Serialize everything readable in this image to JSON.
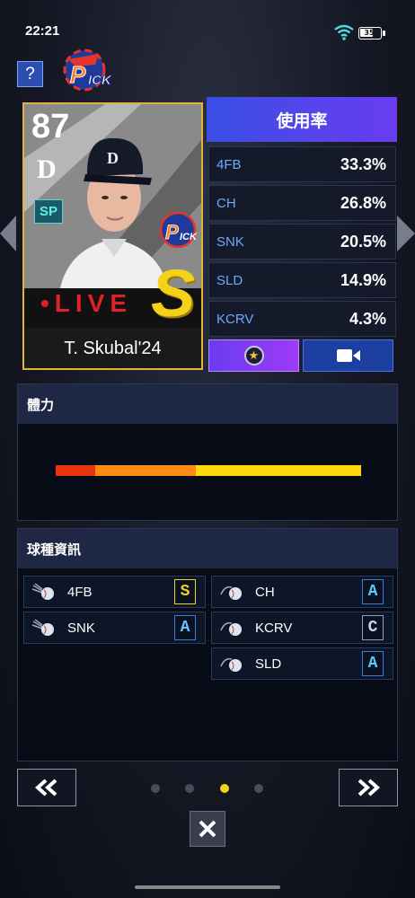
{
  "status": {
    "time": "22:21",
    "battery": "35"
  },
  "header": {
    "help_label": "?"
  },
  "player": {
    "rating": "87",
    "team_logo": "D",
    "position": "SP",
    "live_label": "•LIVE",
    "grade": "S",
    "name": "T. Skubal'24"
  },
  "usage": {
    "header": "使用率",
    "rows": [
      {
        "pitch": "4FB",
        "value": "33.3%"
      },
      {
        "pitch": "CH",
        "value": "26.8%"
      },
      {
        "pitch": "SNK",
        "value": "20.5%"
      },
      {
        "pitch": "SLD",
        "value": "14.9%"
      },
      {
        "pitch": "KCRV",
        "value": "4.3%"
      }
    ]
  },
  "stamina": {
    "title": "體力",
    "segments": [
      0.13,
      0.33,
      0.54
    ]
  },
  "pitches": {
    "title": "球種資訊",
    "items": [
      {
        "name": "4FB",
        "grade": "S"
      },
      {
        "name": "CH",
        "grade": "A"
      },
      {
        "name": "SNK",
        "grade": "A"
      },
      {
        "name": "KCRV",
        "grade": "C"
      },
      {
        "name": "SLD",
        "grade": "A"
      }
    ]
  },
  "pager": {
    "count": 4,
    "active": 3
  },
  "colors": {
    "accent": "#f4d21a",
    "usage_header": "#3a4ee6",
    "live_red": "#e0202a"
  }
}
